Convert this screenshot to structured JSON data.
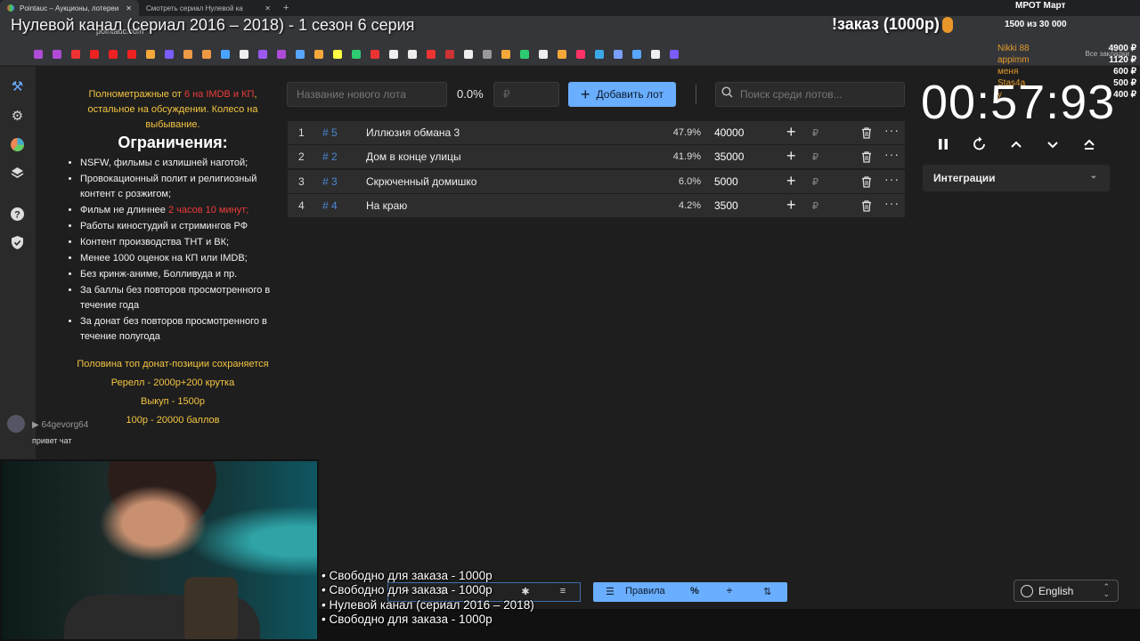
{
  "browser": {
    "tabs": [
      {
        "label": "Pointauc – Аукционы, лотереи"
      },
      {
        "label": "Смотреть сериал Нулевой ка"
      }
    ],
    "url": "pointauc.com",
    "all_bookmarks_label": "Все закладки",
    "bookmark_colors": [
      "#b04bd6",
      "#b04bd6",
      "#e33",
      "#e22",
      "#e22",
      "#e22",
      "#f4a83a",
      "#7a5cff",
      "#e94",
      "#e94",
      "#4aa3ff",
      "#eee",
      "#9b59f0",
      "#b04bd6",
      "#58a6ff",
      "#f4a83a",
      "#ff4",
      "#2ecc71",
      "#e33",
      "#eee",
      "#eee",
      "#e33",
      "#c33",
      "#eee",
      "#999",
      "#f4a83a",
      "#2ecc71",
      "#eee",
      "#f4a83a",
      "#f36",
      "#3aa8e8",
      "#7aa0ff",
      "#58a6ff",
      "#eee",
      "#7a5cff"
    ]
  },
  "stream": {
    "title": "Нулевой канал (сериал 2016 – 2018) - 1 сезон 6 серия",
    "order_label": "!заказ (1000р)",
    "goal_name": "МРОТ Март",
    "goal_progress": "1500 из 30 000",
    "donors": [
      {
        "name": "Nikki 88",
        "amount": "4900 ₽"
      },
      {
        "name": "appimm",
        "amount": "1120 ₽"
      },
      {
        "name": "меня",
        "amount": "600 ₽"
      },
      {
        "name": "Stas4a",
        "amount": "500 ₽"
      },
      {
        "name": "y",
        "amount": "400 ₽"
      }
    ]
  },
  "rules": {
    "intro_a": "Полнометражные от ",
    "intro_red": "6 на IMDB и КП",
    "intro_b": ", остальное на обсуждении. Колесо на выбывание.",
    "heading": "Ограничения:",
    "items": [
      "NSFW, фильмы с излишней наготой;",
      "Провокационный полит и религиозный контент с розжигом;",
      "Фильм не длиннее ",
      "Работы киностудий и стримингов РФ",
      "Контент производства ТНТ и ВК;",
      "Менее 1000 оценок на КП или IMDB;",
      "Без кринж-аниме, Болливуда и пр.",
      "За баллы без повторов просмотренного в течение года",
      "За донат без повторов просмотренного в течение полугода"
    ],
    "duration_red": "2 часов 10 минут;",
    "footer": [
      "Половина топ донат-позиции сохраняется",
      "Ререлл - 2000р+200 крутка",
      "Выкуп - 1500р",
      "100р - 20000 баллов"
    ]
  },
  "chat": {
    "user": "64gevorg64",
    "message": "привет чат"
  },
  "controls": {
    "lot_name_placeholder": "Название нового лота",
    "percent": "0.0%",
    "money_placeholder": "₽",
    "add_label": "Добавить лот",
    "search_placeholder": "Поиск среди лотов..."
  },
  "lots": [
    {
      "index": "1",
      "tag": "# 5",
      "name": "Иллюзия обмана 3",
      "percent": "47.9%",
      "amount": "40000"
    },
    {
      "index": "2",
      "tag": "# 2",
      "name": "Дом в конце улицы",
      "percent": "41.9%",
      "amount": "35000"
    },
    {
      "index": "3",
      "tag": "# 3",
      "name": "Скрюченный домишко",
      "percent": "6.0%",
      "amount": "5000"
    },
    {
      "index": "4",
      "tag": "# 4",
      "name": "На краю",
      "percent": "4.2%",
      "amount": "3500"
    }
  ],
  "lot_currency": "₽",
  "timer": {
    "value": "00:57:93"
  },
  "integrations_label": "Интеграции",
  "bottom": {
    "rules_label": "Правила",
    "language": "English"
  },
  "overlay_list": [
    "• Свободно для заказа - 1000р",
    "• Свободно для заказа - 1000р",
    "• Нулевой канал (сериал 2016 – 2018)",
    "• Свободно для заказа - 1000р"
  ],
  "colors": {
    "accent": "#6aaeff",
    "gold": "#f4c542",
    "red": "#ef3b3b",
    "tag_blue": "#4a88d6"
  }
}
